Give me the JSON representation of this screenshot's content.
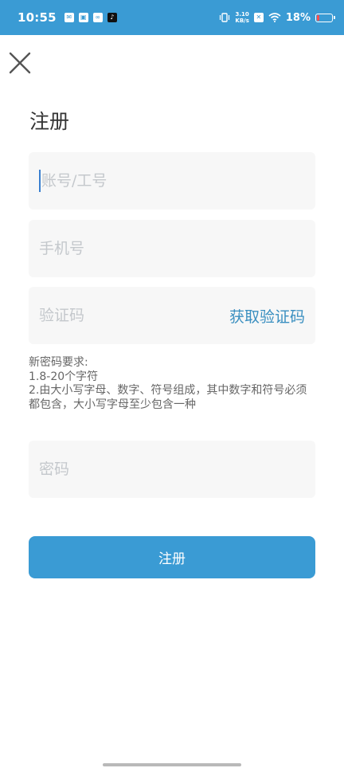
{
  "status_bar": {
    "time": "10:55",
    "net_speed_value": "3.10",
    "net_speed_unit": "KB/s",
    "battery_percent": "18%",
    "battery_level": 0.18
  },
  "page": {
    "title": "注册"
  },
  "form": {
    "account_placeholder": "账号/工号",
    "phone_placeholder": "手机号",
    "code_placeholder": "验证码",
    "get_code_label": "获取验证码",
    "password_placeholder": "密码"
  },
  "rules": {
    "heading": "新密码要求:",
    "line1": "1.8-20个字符",
    "line2": "2.由大小写字母、数字、符号组成，其中数字和符号必须都包含，大小写字母至少包含一种"
  },
  "submit": {
    "label": "注册"
  },
  "colors": {
    "primary": "#3a9bd4",
    "link": "#3a8fc0",
    "battery_low": "#ff4d4d"
  }
}
